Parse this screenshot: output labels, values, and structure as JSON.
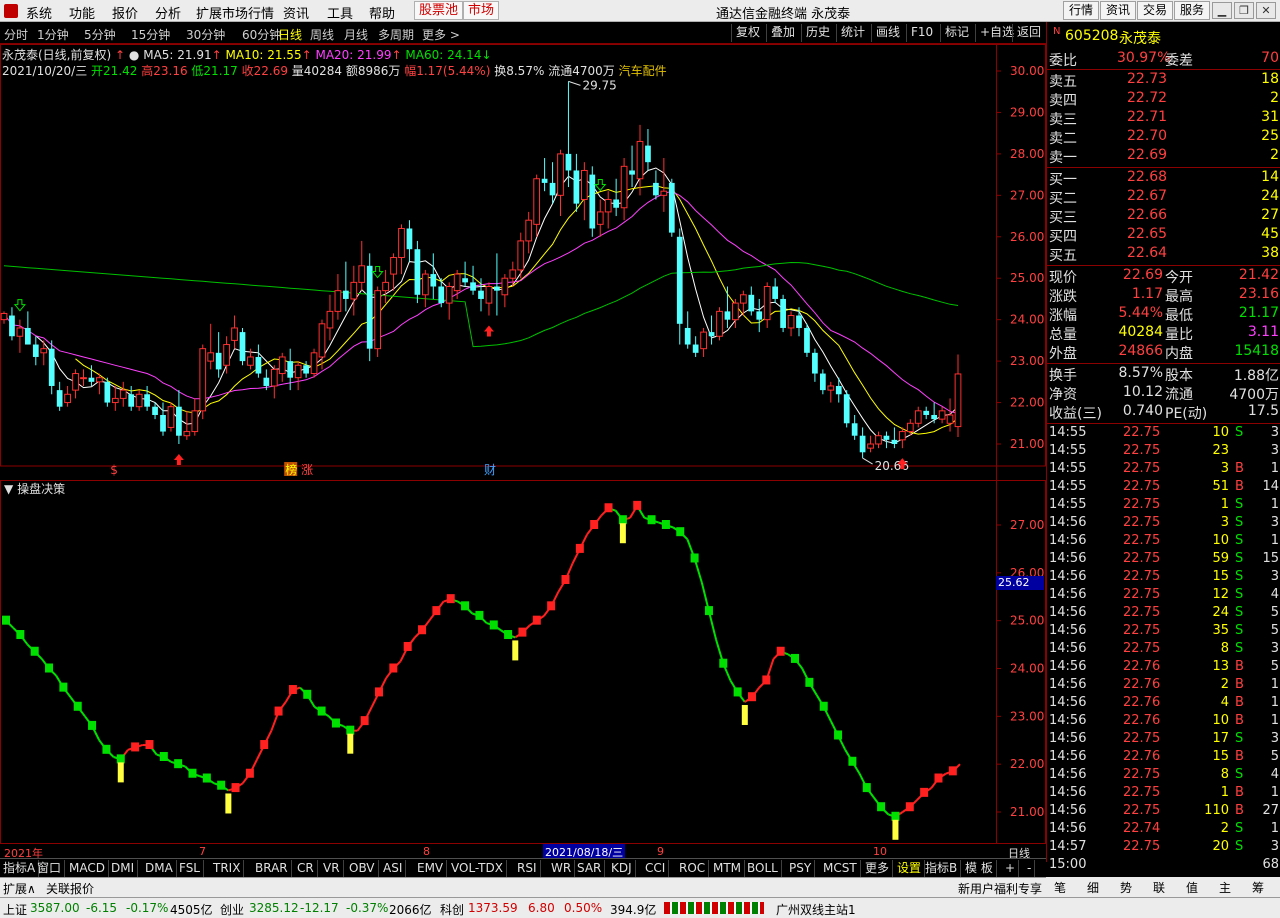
{
  "menu": {
    "items": [
      "系统",
      "功能",
      "报价",
      "分析",
      "扩展市场行情",
      "资讯",
      "工具",
      "帮助"
    ],
    "highlight_items": [
      "股票池",
      "市场"
    ],
    "window_title": "通达信金融终端  永茂泰",
    "right_buttons": [
      "行情",
      "资讯",
      "交易",
      "服务"
    ]
  },
  "periods": {
    "items": [
      "分时",
      "1分钟",
      "5分钟",
      "15分钟",
      "30分钟",
      "60分钟",
      "日线",
      "周线",
      "月线",
      "多周期",
      "更多 >"
    ],
    "active": "日线",
    "tools": [
      "复权",
      "叠加",
      "历史",
      "统计",
      "画线",
      "F10",
      "标记",
      "+自选",
      "返回"
    ]
  },
  "chart_header": {
    "stock_label": "永茂泰(日线,前复权)",
    "ma5": "MA5: 21.91",
    "ma10": "MA10: 21.55",
    "ma20": "MA20: 21.99",
    "ma60": "MA60: 24.14",
    "date": "2021/10/20/三",
    "open": "开21.42",
    "high": "高23.16",
    "low": "低21.17",
    "close": "收22.69",
    "volume": "量40284",
    "amount": "额8986万",
    "change": "幅1.17(5.44%)",
    "turnover": "换8.57%",
    "float": "流通4700万",
    "sector": "汽车配件",
    "max_label": "29.75",
    "min_label": "20.66",
    "event_labels": [
      "$",
      "榜",
      "涨",
      "财"
    ]
  },
  "indicator_title": "操盘决策",
  "indicator_current": "25.62",
  "date_axis": [
    "2021年",
    "7",
    "8",
    "2021/08/18/三",
    "9",
    "10"
  ],
  "period_label": "日线",
  "indicator_tabs": [
    "指标A",
    "窗口",
    "MACD",
    "DMI",
    "DMA",
    "FSL",
    "TRIX",
    "BRAR",
    "CR",
    "VR",
    "OBV",
    "ASI",
    "EMV",
    "VOL-TDX",
    "RSI",
    "WR",
    "SAR",
    "KDJ",
    "CCI",
    "ROC",
    "MTM",
    "BOLL",
    "PSY",
    "MCST",
    "更多",
    "设置"
  ],
  "indicator_right": [
    "指标B",
    "模 板",
    "+",
    "-"
  ],
  "bottom_tabs": [
    "扩展∧",
    "关联报价"
  ],
  "bottom_right": [
    "新用户福利专享"
  ],
  "quote": {
    "code": "605208",
    "name": "永茂泰",
    "weibi_label": "委比",
    "weibi": "30.97%",
    "weicha_label": "委差",
    "weicha": "70",
    "sells": [
      {
        "label": "卖五",
        "price": "22.73",
        "vol": "18"
      },
      {
        "label": "卖四",
        "price": "22.72",
        "vol": "2"
      },
      {
        "label": "卖三",
        "price": "22.71",
        "vol": "31"
      },
      {
        "label": "卖二",
        "price": "22.70",
        "vol": "25"
      },
      {
        "label": "卖一",
        "price": "22.69",
        "vol": "2"
      }
    ],
    "buys": [
      {
        "label": "买一",
        "price": "22.68",
        "vol": "14"
      },
      {
        "label": "买二",
        "price": "22.67",
        "vol": "24"
      },
      {
        "label": "买三",
        "price": "22.66",
        "vol": "27"
      },
      {
        "label": "买四",
        "price": "22.65",
        "vol": "45"
      },
      {
        "label": "买五",
        "price": "22.64",
        "vol": "38"
      }
    ],
    "stats": [
      {
        "l1": "现价",
        "v1": "22.69",
        "l2": "今开",
        "v2": "21.42",
        "c1": "#ff4040",
        "c2": "#ff4040"
      },
      {
        "l1": "涨跌",
        "v1": "1.17",
        "l2": "最高",
        "v2": "23.16",
        "c1": "#ff4040",
        "c2": "#ff4040"
      },
      {
        "l1": "涨幅",
        "v1": "5.44%",
        "l2": "最低",
        "v2": "21.17",
        "c1": "#ff4040",
        "c2": "#00e000"
      },
      {
        "l1": "总量",
        "v1": "40284",
        "l2": "量比",
        "v2": "3.11",
        "c1": "#ffff00",
        "c2": "#ff40ff"
      },
      {
        "l1": "外盘",
        "v1": "24866",
        "l2": "内盘",
        "v2": "15418",
        "c1": "#ff4040",
        "c2": "#00e000"
      }
    ],
    "stats2": [
      {
        "l1": "换手",
        "v1": "8.57%",
        "l2": "股本",
        "v2": "1.88亿"
      },
      {
        "l1": "净资",
        "v1": "10.12",
        "l2": "流通",
        "v2": "4700万"
      },
      {
        "l1": "收益(三)",
        "v1": "0.740",
        "l2": "PE(动)",
        "v2": "17.5"
      }
    ],
    "ticks": [
      {
        "t": "14:55",
        "p": "22.75",
        "v": "10",
        "s": "S",
        "n": "3"
      },
      {
        "t": "14:55",
        "p": "22.75",
        "v": "23",
        "s": "",
        "n": "3"
      },
      {
        "t": "14:55",
        "p": "22.75",
        "v": "3",
        "s": "B",
        "n": "1"
      },
      {
        "t": "14:55",
        "p": "22.75",
        "v": "51",
        "s": "B",
        "n": "14"
      },
      {
        "t": "14:55",
        "p": "22.75",
        "v": "1",
        "s": "S",
        "n": "1"
      },
      {
        "t": "14:56",
        "p": "22.75",
        "v": "3",
        "s": "S",
        "n": "3"
      },
      {
        "t": "14:56",
        "p": "22.75",
        "v": "10",
        "s": "S",
        "n": "1"
      },
      {
        "t": "14:56",
        "p": "22.75",
        "v": "59",
        "s": "S",
        "n": "15"
      },
      {
        "t": "14:56",
        "p": "22.75",
        "v": "15",
        "s": "S",
        "n": "3"
      },
      {
        "t": "14:56",
        "p": "22.75",
        "v": "12",
        "s": "S",
        "n": "4"
      },
      {
        "t": "14:56",
        "p": "22.75",
        "v": "24",
        "s": "S",
        "n": "5"
      },
      {
        "t": "14:56",
        "p": "22.75",
        "v": "35",
        "s": "S",
        "n": "5"
      },
      {
        "t": "14:56",
        "p": "22.75",
        "v": "8",
        "s": "S",
        "n": "3"
      },
      {
        "t": "14:56",
        "p": "22.76",
        "v": "13",
        "s": "B",
        "n": "5"
      },
      {
        "t": "14:56",
        "p": "22.76",
        "v": "2",
        "s": "B",
        "n": "1"
      },
      {
        "t": "14:56",
        "p": "22.76",
        "v": "4",
        "s": "B",
        "n": "1"
      },
      {
        "t": "14:56",
        "p": "22.76",
        "v": "10",
        "s": "B",
        "n": "1"
      },
      {
        "t": "14:56",
        "p": "22.75",
        "v": "17",
        "s": "S",
        "n": "3"
      },
      {
        "t": "14:56",
        "p": "22.76",
        "v": "15",
        "s": "B",
        "n": "5"
      },
      {
        "t": "14:56",
        "p": "22.75",
        "v": "8",
        "s": "S",
        "n": "4"
      },
      {
        "t": "14:56",
        "p": "22.75",
        "v": "1",
        "s": "B",
        "n": "1"
      },
      {
        "t": "14:56",
        "p": "22.75",
        "v": "110",
        "s": "B",
        "n": "27"
      },
      {
        "t": "14:56",
        "p": "22.74",
        "v": "2",
        "s": "S",
        "n": "1"
      },
      {
        "t": "14:57",
        "p": "22.75",
        "v": "20",
        "s": "S",
        "n": "3"
      },
      {
        "t": "15:00",
        "p": "",
        "v": "",
        "s": "",
        "n": "68"
      }
    ],
    "bottom_tabs": [
      "笔",
      "细",
      "势",
      "联",
      "值",
      "主",
      "筹"
    ]
  },
  "status_bar": {
    "items": [
      {
        "label": "上证",
        "value": "3587.00",
        "chg": "-6.15",
        "pct": "-0.17%",
        "amt": "4505亿"
      },
      {
        "label": "创业",
        "value": "3285.12",
        "chg": "-12.17",
        "pct": "-0.37%",
        "amt": "2066亿"
      },
      {
        "label": "科创",
        "value": "1373.59",
        "chg": "6.80",
        "pct": "0.50%",
        "amt": "394.9亿"
      }
    ],
    "server": "广州双线主站1"
  },
  "chart_data": {
    "type": "candlestick",
    "price_axis": [
      30.0,
      29.0,
      28.0,
      27.0,
      26.0,
      25.0,
      24.0,
      23.0,
      22.0,
      21.0
    ],
    "indicator_axis": [
      27.0,
      26.0,
      25.0,
      24.0,
      23.0,
      22.0,
      21.0
    ],
    "candles": [
      [
        24.0,
        24.2,
        23.9,
        24.15
      ],
      [
        24.1,
        24.3,
        23.5,
        23.6
      ],
      [
        23.6,
        24.0,
        23.2,
        23.8
      ],
      [
        23.8,
        24.2,
        23.4,
        23.4
      ],
      [
        23.4,
        23.6,
        22.9,
        23.1
      ],
      [
        23.2,
        23.5,
        22.9,
        23.3
      ],
      [
        23.3,
        23.5,
        22.2,
        22.4
      ],
      [
        22.3,
        22.5,
        21.8,
        21.9
      ],
      [
        22.0,
        22.4,
        21.9,
        22.2
      ],
      [
        22.3,
        22.8,
        22.1,
        22.7
      ],
      [
        22.6,
        22.8,
        22.4,
        22.6
      ],
      [
        22.6,
        22.9,
        22.4,
        22.5
      ],
      [
        22.5,
        22.7,
        22.2,
        22.6
      ],
      [
        22.5,
        22.6,
        21.9,
        22.0
      ],
      [
        22.0,
        22.4,
        21.8,
        22.1
      ],
      [
        22.1,
        22.5,
        21.9,
        22.3
      ],
      [
        22.2,
        22.4,
        21.8,
        21.9
      ],
      [
        21.9,
        22.3,
        21.8,
        22.2
      ],
      [
        22.2,
        22.4,
        21.8,
        21.9
      ],
      [
        21.9,
        22.0,
        21.6,
        21.7
      ],
      [
        21.7,
        22.0,
        21.2,
        21.3
      ],
      [
        21.4,
        22.0,
        21.3,
        21.9
      ],
      [
        21.9,
        22.3,
        21.0,
        21.2
      ],
      [
        21.2,
        21.8,
        21.1,
        21.3
      ],
      [
        21.3,
        22.1,
        21.2,
        21.8
      ],
      [
        21.8,
        23.4,
        21.6,
        23.3
      ],
      [
        23.0,
        23.9,
        22.8,
        23.2
      ],
      [
        23.2,
        23.7,
        22.6,
        22.8
      ],
      [
        22.9,
        23.6,
        22.7,
        23.4
      ],
      [
        23.5,
        24.1,
        23.3,
        23.8
      ],
      [
        23.7,
        23.8,
        22.9,
        23.0
      ],
      [
        22.9,
        23.3,
        22.8,
        23.1
      ],
      [
        23.1,
        23.4,
        22.6,
        22.7
      ],
      [
        22.6,
        22.8,
        22.3,
        22.4
      ],
      [
        22.4,
        22.9,
        22.1,
        22.8
      ],
      [
        22.7,
        23.2,
        22.5,
        23.1
      ],
      [
        23.0,
        23.3,
        22.3,
        22.6
      ],
      [
        22.6,
        23.0,
        22.3,
        22.9
      ],
      [
        22.9,
        23.0,
        22.6,
        22.7
      ],
      [
        22.7,
        23.3,
        22.6,
        23.2
      ],
      [
        23.1,
        24.0,
        22.8,
        23.9
      ],
      [
        23.8,
        24.6,
        23.5,
        24.2
      ],
      [
        24.2,
        25.1,
        24.0,
        24.7
      ],
      [
        24.7,
        25.4,
        24.2,
        24.5
      ],
      [
        24.5,
        25.3,
        24.1,
        24.9
      ],
      [
        24.9,
        25.9,
        24.7,
        25.3
      ],
      [
        25.3,
        25.6,
        23.0,
        23.3
      ],
      [
        23.3,
        24.8,
        23.1,
        24.7
      ],
      [
        24.7,
        25.2,
        24.4,
        24.9
      ],
      [
        25.1,
        25.6,
        24.7,
        25.5
      ],
      [
        25.5,
        26.3,
        25.1,
        26.2
      ],
      [
        26.2,
        26.4,
        25.4,
        25.7
      ],
      [
        25.7,
        25.9,
        24.4,
        24.6
      ],
      [
        24.6,
        25.2,
        24.3,
        25.1
      ],
      [
        25.1,
        25.6,
        24.5,
        24.8
      ],
      [
        24.8,
        25.0,
        24.3,
        24.4
      ],
      [
        24.4,
        24.9,
        24.0,
        24.8
      ],
      [
        24.7,
        25.2,
        24.5,
        25.1
      ],
      [
        25.0,
        25.4,
        24.8,
        24.9
      ],
      [
        24.9,
        25.3,
        24.6,
        24.7
      ],
      [
        24.7,
        25.0,
        24.2,
        24.5
      ],
      [
        24.4,
        24.9,
        24.1,
        24.8
      ],
      [
        24.8,
        25.6,
        24.1,
        24.7
      ],
      [
        24.6,
        25.1,
        24.3,
        25.0
      ],
      [
        25.0,
        25.4,
        24.8,
        25.2
      ],
      [
        25.2,
        26.1,
        25.0,
        25.9
      ],
      [
        25.9,
        26.6,
        25.6,
        26.4
      ],
      [
        26.3,
        27.5,
        26.0,
        27.4
      ],
      [
        27.4,
        27.9,
        27.1,
        27.3
      ],
      [
        27.3,
        27.8,
        26.8,
        27.0
      ],
      [
        27.0,
        28.1,
        26.5,
        28.0
      ],
      [
        28.0,
        29.75,
        27.2,
        27.6
      ],
      [
        27.6,
        28.0,
        26.6,
        26.8
      ],
      [
        26.9,
        27.8,
        26.4,
        27.6
      ],
      [
        27.5,
        27.7,
        26.0,
        26.2
      ],
      [
        26.3,
        26.9,
        26.0,
        26.6
      ],
      [
        26.6,
        27.1,
        26.2,
        26.9
      ],
      [
        26.9,
        27.4,
        26.5,
        26.7
      ],
      [
        26.7,
        27.9,
        26.4,
        27.7
      ],
      [
        27.6,
        28.2,
        27.2,
        27.5
      ],
      [
        27.4,
        28.7,
        27.0,
        28.3
      ],
      [
        28.2,
        28.6,
        27.6,
        27.8
      ],
      [
        27.3,
        27.6,
        26.9,
        27.0
      ],
      [
        27.0,
        27.9,
        26.6,
        27.1
      ],
      [
        27.3,
        27.4,
        26.0,
        26.1
      ],
      [
        26.0,
        26.2,
        23.4,
        23.9
      ],
      [
        23.8,
        24.2,
        23.3,
        23.4
      ],
      [
        23.4,
        23.6,
        23.1,
        23.2
      ],
      [
        23.3,
        23.8,
        23.1,
        23.7
      ],
      [
        23.7,
        24.1,
        23.4,
        23.6
      ],
      [
        23.6,
        24.3,
        23.5,
        24.2
      ],
      [
        24.2,
        24.8,
        23.8,
        24.0
      ],
      [
        24.0,
        24.5,
        23.8,
        24.4
      ],
      [
        24.4,
        24.7,
        24.1,
        24.6
      ],
      [
        24.6,
        24.8,
        24.1,
        24.2
      ],
      [
        24.2,
        24.5,
        23.7,
        24.0
      ],
      [
        24.0,
        24.9,
        23.8,
        24.8
      ],
      [
        24.8,
        25.0,
        24.4,
        24.5
      ],
      [
        24.5,
        24.6,
        23.7,
        23.8
      ],
      [
        23.8,
        24.2,
        23.6,
        24.1
      ],
      [
        24.1,
        24.3,
        23.6,
        23.8
      ],
      [
        23.8,
        23.9,
        23.1,
        23.2
      ],
      [
        23.2,
        23.3,
        22.5,
        22.7
      ],
      [
        22.7,
        22.8,
        22.2,
        22.3
      ],
      [
        22.3,
        22.5,
        22.0,
        22.4
      ],
      [
        22.4,
        22.6,
        22.0,
        22.2
      ],
      [
        22.2,
        22.3,
        21.4,
        21.5
      ],
      [
        21.5,
        21.7,
        21.1,
        21.2
      ],
      [
        21.2,
        21.4,
        20.66,
        20.8
      ],
      [
        20.9,
        21.2,
        20.8,
        21.0
      ],
      [
        21.0,
        21.3,
        20.9,
        21.2
      ],
      [
        21.2,
        21.3,
        20.9,
        21.1
      ],
      [
        21.1,
        21.4,
        20.9,
        21.0
      ],
      [
        21.1,
        21.4,
        20.9,
        21.3
      ],
      [
        21.3,
        21.6,
        21.2,
        21.5
      ],
      [
        21.5,
        21.9,
        21.4,
        21.8
      ],
      [
        21.8,
        21.9,
        21.6,
        21.7
      ],
      [
        21.7,
        22.0,
        21.5,
        21.6
      ],
      [
        21.6,
        21.9,
        21.5,
        21.8
      ],
      [
        21.5,
        22.1,
        21.3,
        21.7
      ],
      [
        21.42,
        23.16,
        21.17,
        22.69
      ]
    ],
    "indicator_values": [
      25.0,
      24.85,
      24.7,
      24.5,
      24.35,
      24.2,
      24.0,
      23.85,
      23.6,
      23.4,
      23.2,
      23.0,
      22.8,
      22.5,
      22.3,
      22.15,
      22.1,
      22.3,
      22.35,
      22.4,
      22.4,
      22.2,
      22.15,
      22.05,
      22.0,
      21.95,
      21.8,
      21.75,
      21.7,
      21.6,
      21.55,
      21.45,
      21.5,
      21.6,
      21.8,
      22.1,
      22.4,
      22.7,
      23.1,
      23.3,
      23.55,
      23.6,
      23.45,
      23.2,
      23.1,
      23.0,
      22.85,
      22.8,
      22.7,
      22.7,
      22.9,
      23.2,
      23.5,
      23.8,
      24.0,
      24.15,
      24.45,
      24.65,
      24.8,
      25.0,
      25.2,
      25.4,
      25.45,
      25.4,
      25.3,
      25.15,
      25.1,
      24.95,
      24.9,
      24.8,
      24.7,
      24.65,
      24.75,
      24.9,
      25.0,
      25.1,
      25.3,
      25.6,
      25.85,
      26.2,
      26.5,
      26.8,
      27.0,
      27.2,
      27.35,
      27.3,
      27.1,
      27.15,
      27.4,
      27.15,
      27.1,
      27.05,
      27.0,
      26.95,
      26.85,
      26.7,
      26.3,
      25.8,
      25.2,
      24.6,
      24.1,
      23.75,
      23.5,
      23.3,
      23.4,
      23.6,
      23.75,
      24.2,
      24.35,
      24.3,
      24.2,
      24.0,
      23.7,
      23.45,
      23.2,
      22.9,
      22.6,
      22.3,
      22.05,
      21.8,
      21.5,
      21.3,
      21.1,
      20.95,
      20.9,
      21.0,
      21.1,
      21.25,
      21.4,
      21.5,
      21.7,
      21.8,
      21.85,
      22.0
    ]
  }
}
